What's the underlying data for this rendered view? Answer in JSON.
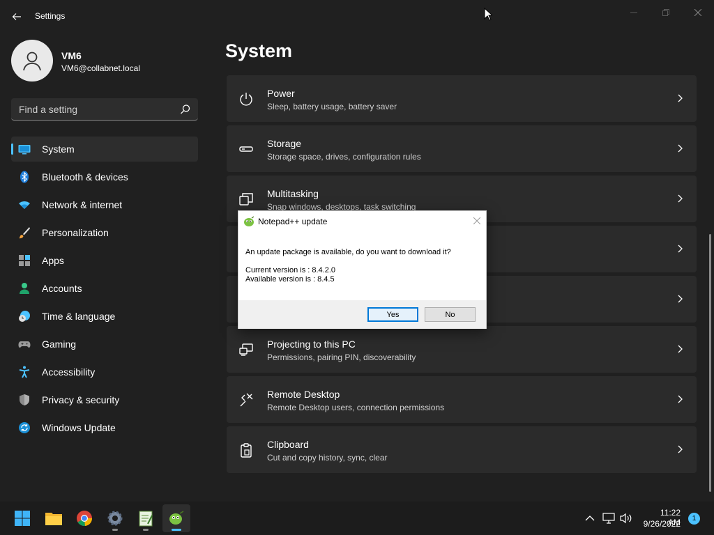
{
  "window": {
    "title": "Settings"
  },
  "profile": {
    "name": "VM6",
    "email": "VM6@collabnet.local"
  },
  "search": {
    "placeholder": "Find a setting"
  },
  "nav": {
    "items": [
      {
        "label": "System",
        "icon": "monitor-icon",
        "active": true
      },
      {
        "label": "Bluetooth & devices",
        "icon": "bluetooth-icon"
      },
      {
        "label": "Network & internet",
        "icon": "wifi-icon"
      },
      {
        "label": "Personalization",
        "icon": "brush-icon"
      },
      {
        "label": "Apps",
        "icon": "apps-icon"
      },
      {
        "label": "Accounts",
        "icon": "person-icon"
      },
      {
        "label": "Time & language",
        "icon": "globe-clock-icon"
      },
      {
        "label": "Gaming",
        "icon": "gamepad-icon"
      },
      {
        "label": "Accessibility",
        "icon": "accessibility-icon"
      },
      {
        "label": "Privacy & security",
        "icon": "shield-icon"
      },
      {
        "label": "Windows Update",
        "icon": "update-icon"
      }
    ]
  },
  "main": {
    "title": "System",
    "cards": [
      {
        "title": "Power",
        "subtitle": "Sleep, battery usage, battery saver",
        "icon": "power-icon"
      },
      {
        "title": "Storage",
        "subtitle": "Storage space, drives, configuration rules",
        "icon": "storage-icon"
      },
      {
        "title": "Multitasking",
        "subtitle": "Snap windows, desktops, task switching",
        "icon": "multitasking-icon"
      },
      {
        "title": "",
        "subtitle": "",
        "icon": ""
      },
      {
        "title": "",
        "subtitle": "",
        "icon": ""
      },
      {
        "title": "Projecting to this PC",
        "subtitle": "Permissions, pairing PIN, discoverability",
        "icon": "projecting-icon"
      },
      {
        "title": "Remote Desktop",
        "subtitle": "Remote Desktop users, connection permissions",
        "icon": "remote-desktop-icon"
      },
      {
        "title": "Clipboard",
        "subtitle": "Cut and copy history, sync, clear",
        "icon": "clipboard-icon"
      }
    ]
  },
  "dialog": {
    "title": "Notepad++ update",
    "message": "An update package is available, do you want to download it?",
    "current_version": "Current version is   : 8.4.2.0",
    "available_version": "Available version is : 8.4.5",
    "yes_label": "Yes",
    "no_label": "No"
  },
  "taskbar": {
    "apps": [
      "start-icon",
      "file-explorer-icon",
      "chrome-icon",
      "settings-icon",
      "notepad-icon",
      "notepad-plus-plus-icon"
    ],
    "time": "11:22 AM",
    "date": "9/26/2022",
    "notification_count": "1"
  },
  "colors": {
    "accent": "#4cc2ff",
    "background": "#202020",
    "card": "#2b2b2b"
  }
}
